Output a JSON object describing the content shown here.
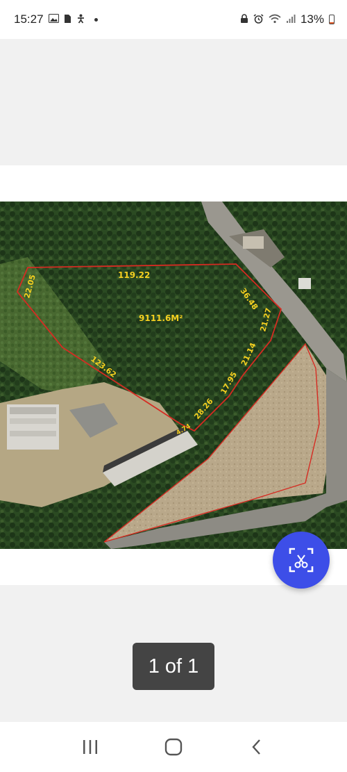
{
  "status_bar": {
    "time": "15:27",
    "battery": "13%",
    "battery_level": 0.13,
    "left_icons": [
      "gallery-icon",
      "sim-icon",
      "accessibility-icon",
      "dot-icon"
    ],
    "right_icons": [
      "lock-icon",
      "alarm-icon",
      "wifi-icon",
      "signal-icon",
      "battery-icon"
    ]
  },
  "viewer": {
    "page_counter": "1 of 1",
    "fab_icon": "screenshot-crop-icon"
  },
  "map": {
    "labels": {
      "top": "119.22",
      "left_top": "22.05",
      "right_top": "36.48",
      "right_mid": "21.27",
      "right_lower": "21.14",
      "lower_a": "17.95",
      "lower_b": "28.26",
      "lower_c": "4.74",
      "diagonal": "123.62",
      "area": "9111.6M²"
    },
    "colors": {
      "boundary": "#d62b22",
      "label": "#f5d020"
    }
  },
  "nav": {
    "recent_icon": "recent-apps-icon",
    "home_icon": "home-icon",
    "back_icon": "back-icon"
  }
}
